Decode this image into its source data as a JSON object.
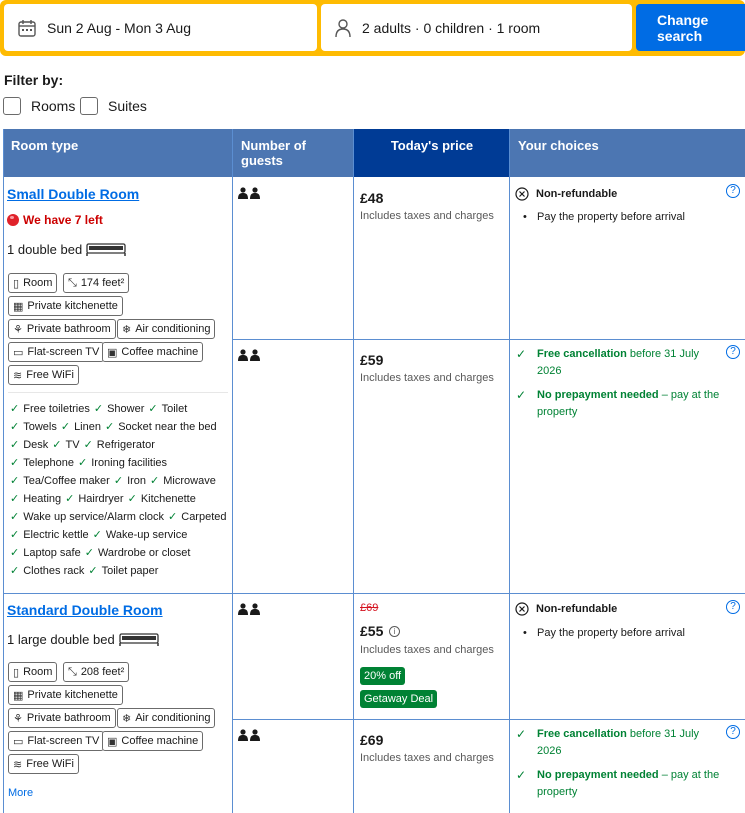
{
  "search": {
    "dates": "Sun 2 Aug - Mon 3 Aug",
    "guests": "2 adults · 0 children · 1 room",
    "button": "Change search"
  },
  "filter": {
    "title": "Filter by:",
    "options": [
      "Rooms",
      "Suites"
    ]
  },
  "table": {
    "headers": [
      "Room type",
      "Number of guests",
      "Today's price",
      "Your choices"
    ]
  },
  "rooms": [
    {
      "name": "Small Double Room",
      "alert": "We have 7 left",
      "bed": "1 double bed",
      "chips": [
        "Room",
        "174 feet²",
        "Private kitchenette",
        "Private bathroom",
        "Air conditioning",
        "Flat-screen TV",
        "Coffee machine",
        "Free WiFi"
      ],
      "facilities": [
        [
          "Free toiletries",
          "Shower",
          "Toilet"
        ],
        [
          "Towels",
          "Linen",
          "Socket near the bed"
        ],
        [
          "Desk",
          "TV",
          "Refrigerator"
        ],
        [
          "Telephone",
          "Ironing facilities"
        ],
        [
          "Tea/Coffee maker",
          "Iron",
          "Microwave"
        ],
        [
          "Heating",
          "Hairdryer",
          "Kitchenette"
        ],
        [
          "Wake up service/Alarm clock",
          "Carpeted"
        ],
        [
          "Electric kettle",
          "Wake-up service"
        ],
        [
          "Laptop safe",
          "Wardrobe or closet"
        ],
        [
          "Clothes rack",
          "Toilet paper"
        ]
      ],
      "options": [
        {
          "price": "£48",
          "taxes": "Includes taxes and charges",
          "choice_title": "Non-refundable",
          "choice_bullet": "Pay the property before arrival"
        },
        {
          "price": "£59",
          "taxes": "Includes taxes and charges",
          "free_cancel_bold": "Free cancellation",
          "free_cancel_rest": " before 31 July 2026",
          "no_prepay_bold": "No prepayment needed",
          "no_prepay_rest": " – pay at the property"
        }
      ]
    },
    {
      "name": "Standard Double Room",
      "bed": "1 large double bed",
      "chips": [
        "Room",
        "208 feet²",
        "Private kitchenette",
        "Private bathroom",
        "Air conditioning",
        "Flat-screen TV",
        "Coffee machine",
        "Free WiFi"
      ],
      "more": "More",
      "options": [
        {
          "old_price": "£69",
          "price": "£55",
          "taxes": "Includes taxes and charges",
          "badges": [
            "20% off",
            "Getaway Deal"
          ],
          "choice_title": "Non-refundable",
          "choice_bullet": "Pay the property before arrival"
        },
        {
          "price": "£69",
          "taxes": "Includes taxes and charges",
          "free_cancel_bold": "Free cancellation",
          "free_cancel_rest": " before 31 July 2026",
          "no_prepay_bold": "No prepayment needed",
          "no_prepay_rest": " – pay at the property"
        }
      ]
    }
  ],
  "icons": {
    "calendar": "calendar-icon",
    "person": "person-icon",
    "guests": "two-persons-icon",
    "check": "check-icon",
    "help": "help-icon"
  },
  "colors": {
    "brand_yellow": "#febb02",
    "brand_blue": "#006ce4",
    "header_blue": "#4c76b2",
    "header_dark": "#003b95",
    "green": "#008234",
    "red": "#d4111e"
  }
}
